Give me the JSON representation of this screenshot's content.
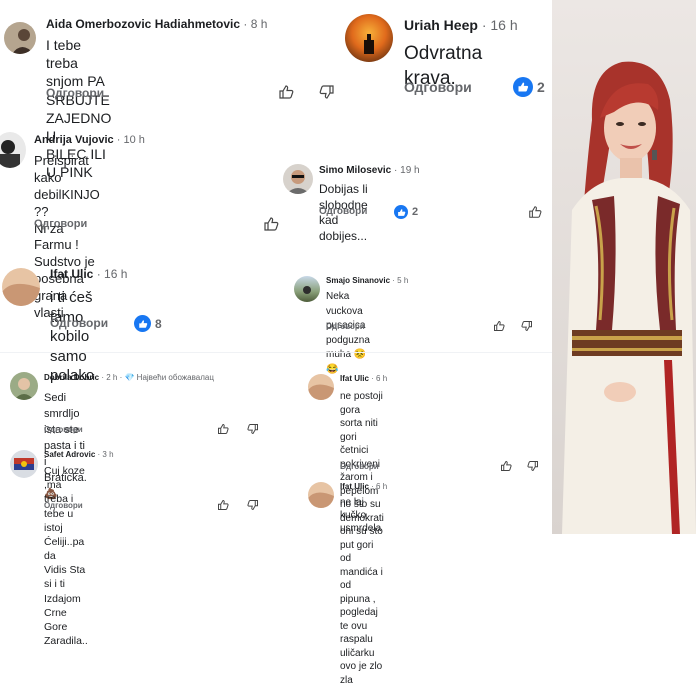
{
  "comments": [
    {
      "name": "Aida Omerbozovic Hadiahmetovic",
      "time": "· 8 h",
      "text": "I tebe treba snjom PA SRBUJTE ZAJEDNO U\nBILEC ILI U PINK",
      "reply": "Одговори"
    },
    {
      "name": "Uriah Heep",
      "time": "· 16 h",
      "text": "Odvratna krava.",
      "reply": "Одговори",
      "likes": "2"
    },
    {
      "name": "Andrija Vujovic",
      "time": "· 10 h",
      "text": "Preispirat kako debilKINJO ??\nNi za Farmu !\nSudstvo je posebna grana vlasti",
      "reply": "Одговори"
    },
    {
      "name": "Simo Milosevic",
      "time": "· 19 h",
      "text": "Dobijas li slobodne kad dobijes...",
      "reply": "Одговори",
      "likes": "2"
    },
    {
      "name": "Ifat Ulic",
      "time": "· 16 h",
      "text": "i ti ćeš tamo kobilo samo polako",
      "reply": "Одговори",
      "likes": "8"
    },
    {
      "name": "Smajo Sinanovic",
      "time": "· 5 h",
      "text": "Neka vuckova pusacica podguzna muha 😣\n😂",
      "reply": "Одговори"
    },
    {
      "name": "Dobrila Dobric",
      "time": "· 2 h · 💎 Највећи обожавалац",
      "text": "Sedi smrdljo ista ste pasta i ti i Braticka.\n💩",
      "reply": "Одговори"
    },
    {
      "name": "Ifat Ulic",
      "time": "· 6 h",
      "text": "ne postoji gora sorta niti gori četnici\npokriveni žarom i pepelom no što su\ndemokrati oni su sto put gori od mandića i\nod pipuna  , pogledaj te ovu raspalu uličarku\novo je zlo zla",
      "reply": "Одговори"
    },
    {
      "name": "Safet Adrovic",
      "time": "· 3 h",
      "text": "Cuj koze ,ma treba i tebe u istoj Ćeliji..pa da\nVidis Sta si i ti Izdajom Crne Gore Zaradila..",
      "reply": "Одговори"
    },
    {
      "name": "Ifat Ulic",
      "time": "· 6 h",
      "text": "ne laj kučko usmrdela",
      "reply": "Одговори"
    }
  ],
  "colors": {
    "like_blue": "#1877f2",
    "secondary_text": "#65676b",
    "dress": "#f4efe6",
    "hair": "#a8332b"
  }
}
